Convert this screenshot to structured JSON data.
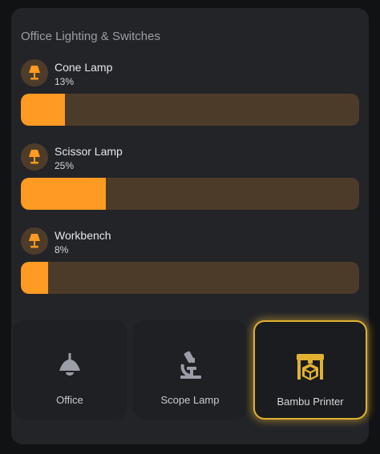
{
  "card": {
    "title": "Office Lighting & Switches"
  },
  "entities": [
    {
      "name": "Cone Lamp",
      "value": "13%",
      "level": 0.13,
      "icon": "lamp-icon"
    },
    {
      "name": "Scissor Lamp",
      "value": "25%",
      "level": 0.25,
      "icon": "lamp-icon"
    },
    {
      "name": "Workbench",
      "value": "8%",
      "level": 0.08,
      "icon": "lamp-icon"
    }
  ],
  "buttons": [
    {
      "label": "Office",
      "icon": "ceiling-light-icon",
      "active": false
    },
    {
      "label": "Scope Lamp",
      "icon": "microscope-icon",
      "active": false
    },
    {
      "label": "Bambu Printer",
      "icon": "printer-3d-icon",
      "active": true
    }
  ],
  "colors": {
    "accent": "#ff9a22",
    "slider_track": "#4d3b29",
    "active_border": "#e2b131",
    "icon_grey": "#9b9ea6"
  }
}
